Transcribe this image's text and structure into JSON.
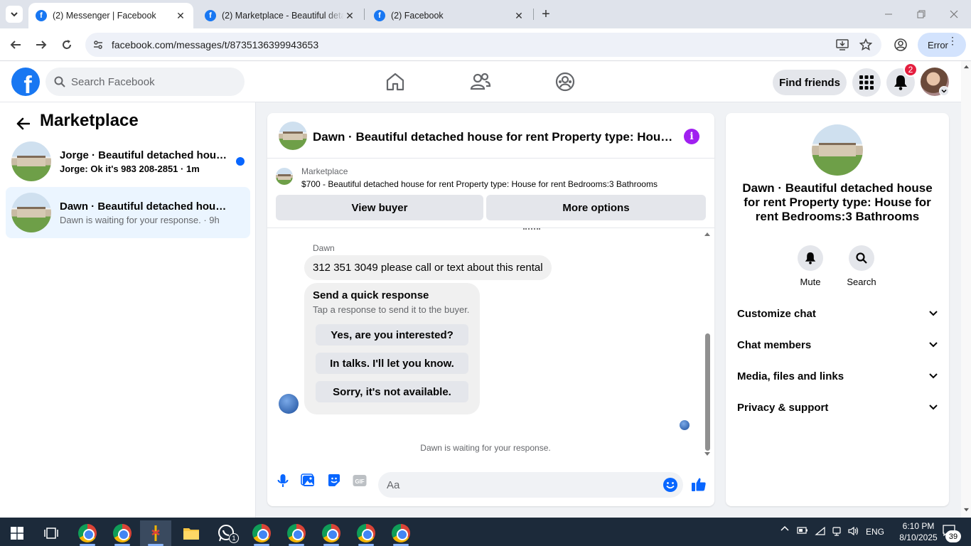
{
  "browser": {
    "tabs": [
      {
        "title": "(2) Messenger | Facebook",
        "active": true
      },
      {
        "title": "(2) Marketplace - Beautiful deta",
        "active": false
      },
      {
        "title": "(2) Facebook",
        "active": false
      }
    ],
    "url": "facebook.com/messages/t/8735136399943653",
    "profile_error_label": "Error"
  },
  "fb_header": {
    "search_placeholder": "Search Facebook",
    "find_friends_label": "Find friends",
    "notification_count": "2"
  },
  "sidebar": {
    "title": "Marketplace",
    "conversations": [
      {
        "title": "Jorge · Beautiful detached house...",
        "preview": "Jorge: Ok it's 983 208-2851 · 1m",
        "unread": true,
        "selected": false
      },
      {
        "title": "Dawn · Beautiful detached house f...",
        "preview": "Dawn is waiting for your response. · 9h",
        "unread": false,
        "selected": true
      }
    ]
  },
  "chat": {
    "title": "Dawn · Beautiful detached house for rent Property type: House ...",
    "listing_label": "Marketplace",
    "listing_description": "$700 - Beautiful detached house for rent Property type: House for rent Bedrooms:3 Bathrooms",
    "view_buyer_label": "View buyer",
    "more_options_label": "More options",
    "sender_name": "Dawn",
    "message": "312 351 3049 please call or text about this rental",
    "quick_response": {
      "title": "Send a quick response",
      "subtitle": "Tap a response to send it to the buyer.",
      "options": [
        "Yes, are you interested?",
        "In talks. I'll let you know.",
        "Sorry, it's not available."
      ]
    },
    "status_text": "Dawn is waiting for your response.",
    "input_placeholder": "Aa"
  },
  "details_panel": {
    "title": "Dawn · Beautiful detached house for rent Property type: House for rent Bedrooms:3 Bathrooms",
    "actions": [
      "Mute",
      "Search"
    ],
    "sections": [
      "Customize chat",
      "Chat members",
      "Media, files and links",
      "Privacy & support"
    ]
  },
  "taskbar": {
    "time": "6:10 PM",
    "date": "8/10/2025",
    "language": "ENG",
    "whatsapp_badge": "1",
    "notification_badge": "39"
  },
  "colors": {
    "facebook_blue": "#1877f2",
    "messenger_blue": "#0866ff",
    "info_purple": "#a020f0",
    "badge_red": "#e41e3f"
  }
}
